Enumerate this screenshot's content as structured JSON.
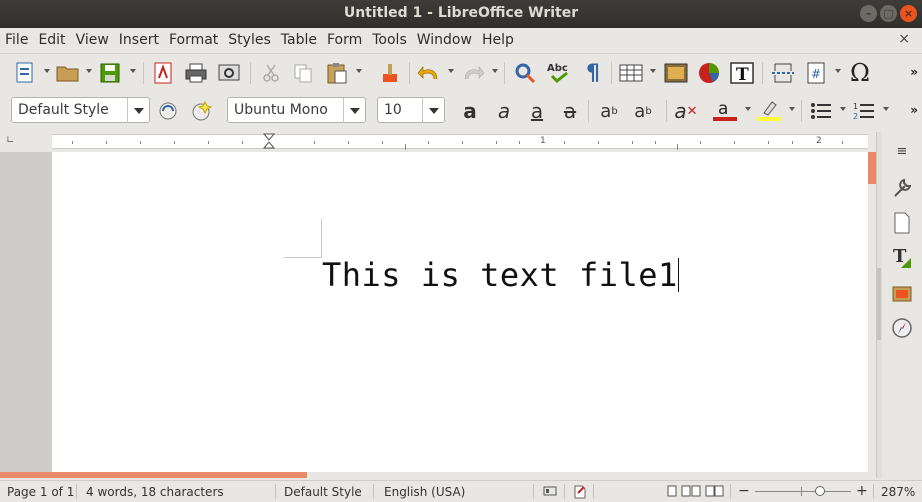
{
  "window": {
    "title": "Untitled 1 - LibreOffice Writer"
  },
  "menu": [
    "File",
    "Edit",
    "View",
    "Insert",
    "Format",
    "Styles",
    "Table",
    "Form",
    "Tools",
    "Window",
    "Help"
  ],
  "doc_close_label": "×",
  "toolbar2": {
    "paragraph_style": "Default Style",
    "font_name": "Ubuntu Mono",
    "font_size": "10"
  },
  "ruler": {
    "numbers": [
      "1",
      "1",
      "2"
    ]
  },
  "document": {
    "text": "This is text file1"
  },
  "status": {
    "page": "Page 1 of 1",
    "words": "4 words, 18 characters",
    "style": "Default Style",
    "language": "English (USA)",
    "zoom": "287%"
  },
  "colors": {
    "accent": "#e9541f",
    "scroll_thumb": "#e9896a",
    "font_color": "#c9211e",
    "highlight": "#ffff38"
  },
  "icons": {
    "more": "»"
  }
}
